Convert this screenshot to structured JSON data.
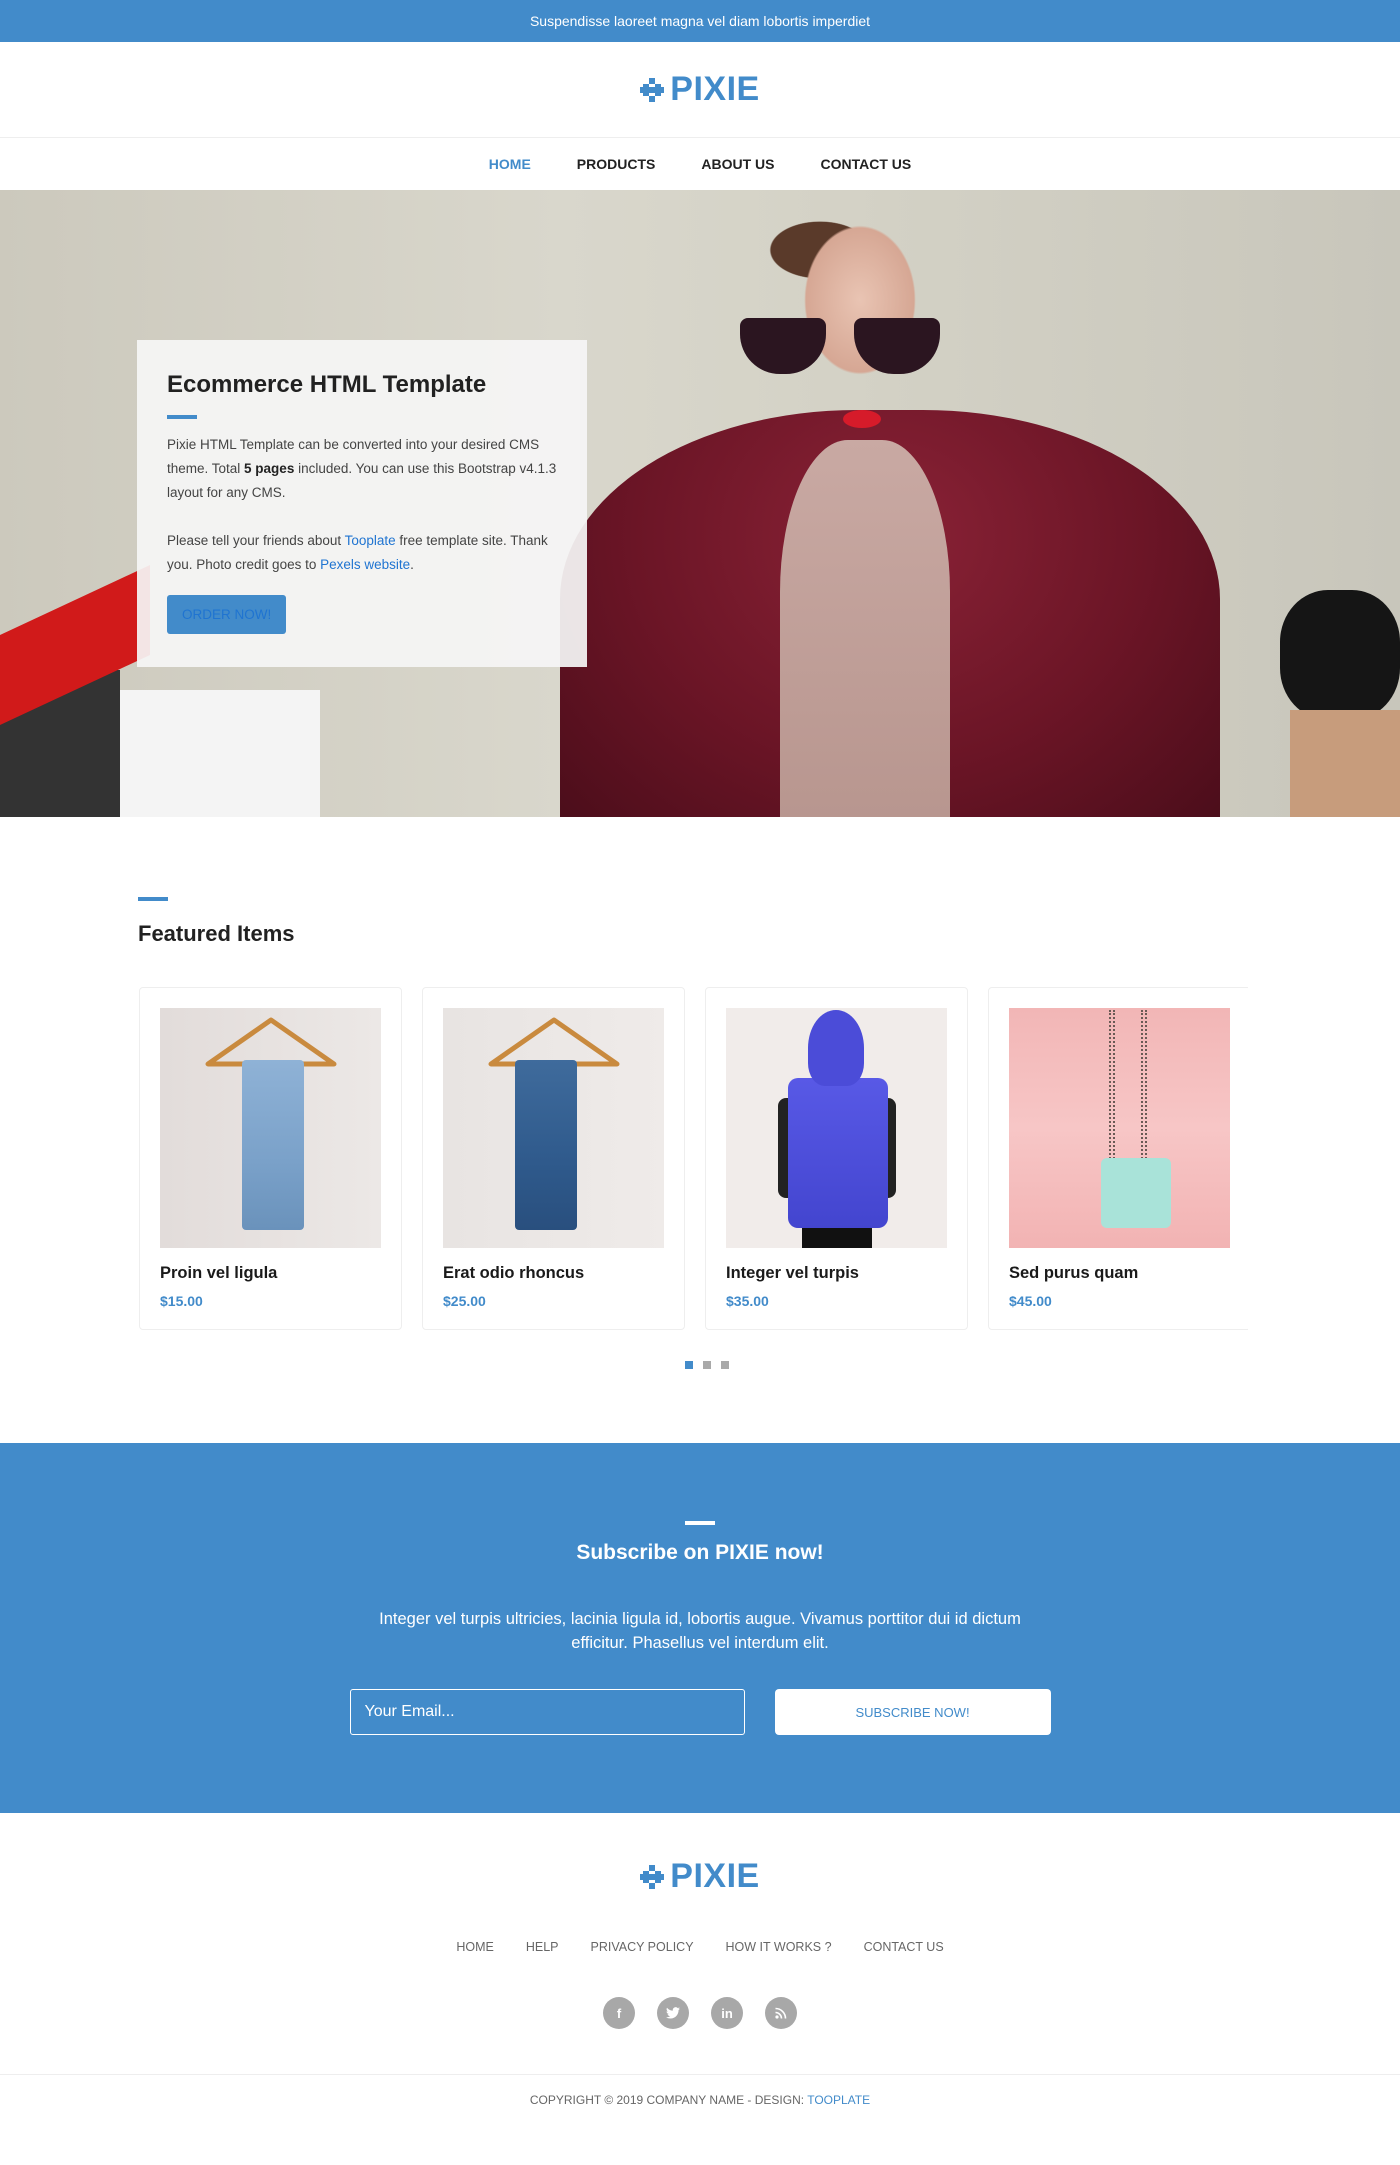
{
  "topbar": {
    "text": "Suspendisse laoreet magna vel diam lobortis imperdiet"
  },
  "brand": {
    "name": "PIXIE",
    "color": "#428bca"
  },
  "nav": {
    "items": [
      {
        "label": "HOME",
        "active": true
      },
      {
        "label": "PRODUCTS"
      },
      {
        "label": "ABOUT US"
      },
      {
        "label": "CONTACT US"
      }
    ]
  },
  "hero": {
    "title": "Ecommerce HTML Template",
    "p1_a": "Pixie HTML Template can be converted into your desired CMS theme. Total ",
    "p1_bold": "5 pages",
    "p1_b": " included. You can use this Bootstrap v4.1.3 layout for any CMS.",
    "p2_a": "Please tell your friends about ",
    "p2_link1": "Tooplate",
    "p2_b": " free template site. Thank you. Photo credit goes to ",
    "p2_link2": "Pexels website",
    "p2_c": ".",
    "button": "ORDER NOW!"
  },
  "featured": {
    "title": "Featured Items",
    "items": [
      {
        "name": "Proin vel ligula",
        "price": "$15.00",
        "image": "light-jeans-on-hanger"
      },
      {
        "name": "Erat odio rhoncus",
        "price": "$25.00",
        "image": "dark-jeans-on-hanger"
      },
      {
        "name": "Integer vel turpis",
        "price": "$35.00",
        "image": "blue-puffer-vest"
      },
      {
        "name": "Sed purus quam",
        "price": "$45.00",
        "image": "mint-backpack-on-pink"
      }
    ],
    "pagination": {
      "pages": 3,
      "current": 1
    }
  },
  "subscribe": {
    "title": "Subscribe on PIXIE now!",
    "text": "Integer vel turpis ultricies, lacinia ligula id, lobortis augue. Vivamus porttitor dui id dictum efficitur. Phasellus vel interdum elit.",
    "email_placeholder": "Your Email...",
    "button": "SUBSCRIBE NOW!"
  },
  "footer": {
    "links": [
      "HOME",
      "HELP",
      "PRIVACY POLICY",
      "HOW IT WORKS ?",
      "CONTACT US"
    ],
    "socials": [
      {
        "icon": "facebook-icon",
        "glyph": "f"
      },
      {
        "icon": "twitter-icon",
        "glyph": "t"
      },
      {
        "icon": "linkedin-icon",
        "glyph": "in"
      },
      {
        "icon": "rss-icon",
        "glyph": "◝"
      }
    ],
    "copyright": "COPYRIGHT © 2019 COMPANY NAME - DESIGN: ",
    "design_link": "TOOPLATE"
  }
}
